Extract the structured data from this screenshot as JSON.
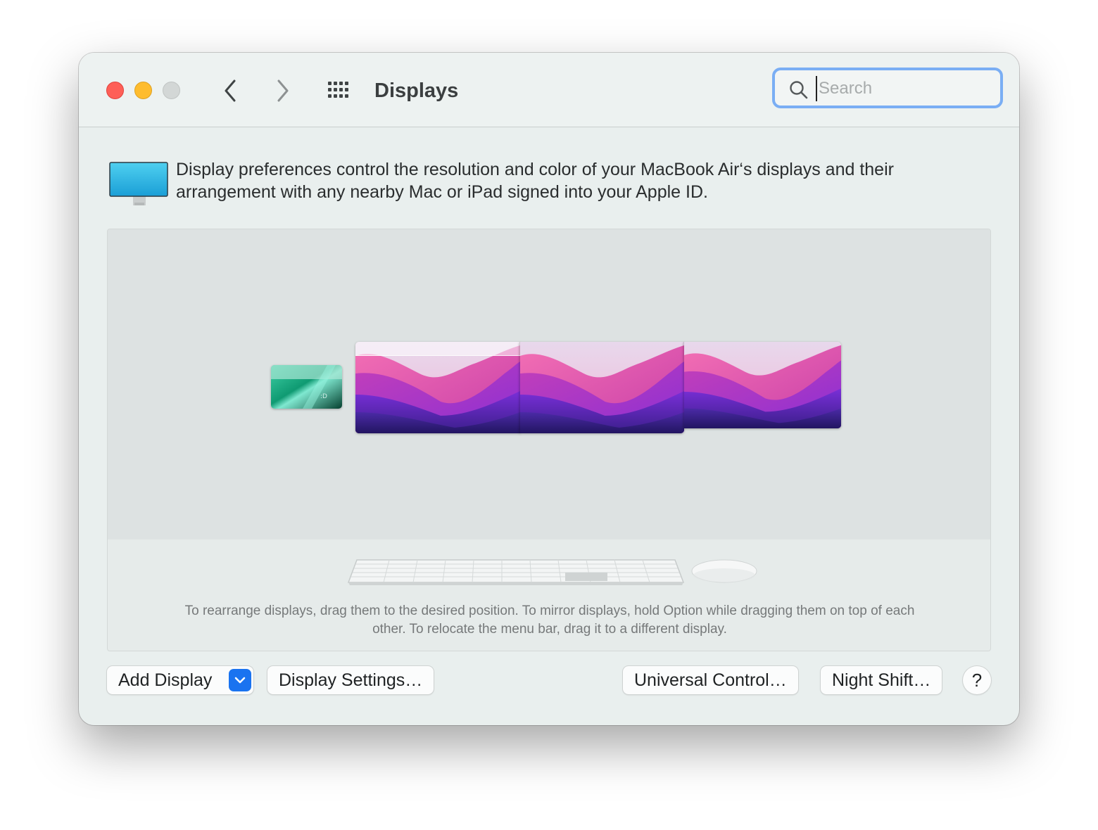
{
  "window": {
    "title": "Displays",
    "search_placeholder": "Search"
  },
  "intro": {
    "text": "Display preferences control the resolution and color of your MacBook Air‘s displays and their arrangement with any nearby Mac or iPad signed into your Apple ID."
  },
  "arrangement": {
    "displays": [
      "ipad-display",
      "main-display-with-menu-bar",
      "second-display",
      "third-display"
    ],
    "hint": "To rearrange displays, drag them to the desired position. To mirror displays, hold Option while dragging them on top of each other. To relocate the menu bar, drag it to a different display."
  },
  "buttons": {
    "add_display": "Add Display",
    "display_settings": "Display Settings…",
    "universal_control": "Universal Control…",
    "night_shift": "Night Shift…",
    "help": "?"
  },
  "colors": {
    "accent": "#1a73f0",
    "search_focus": "#7aaef4",
    "close": "#fe5f57",
    "minimize": "#febc2e",
    "zoom_disabled": "#d3d7d6"
  }
}
